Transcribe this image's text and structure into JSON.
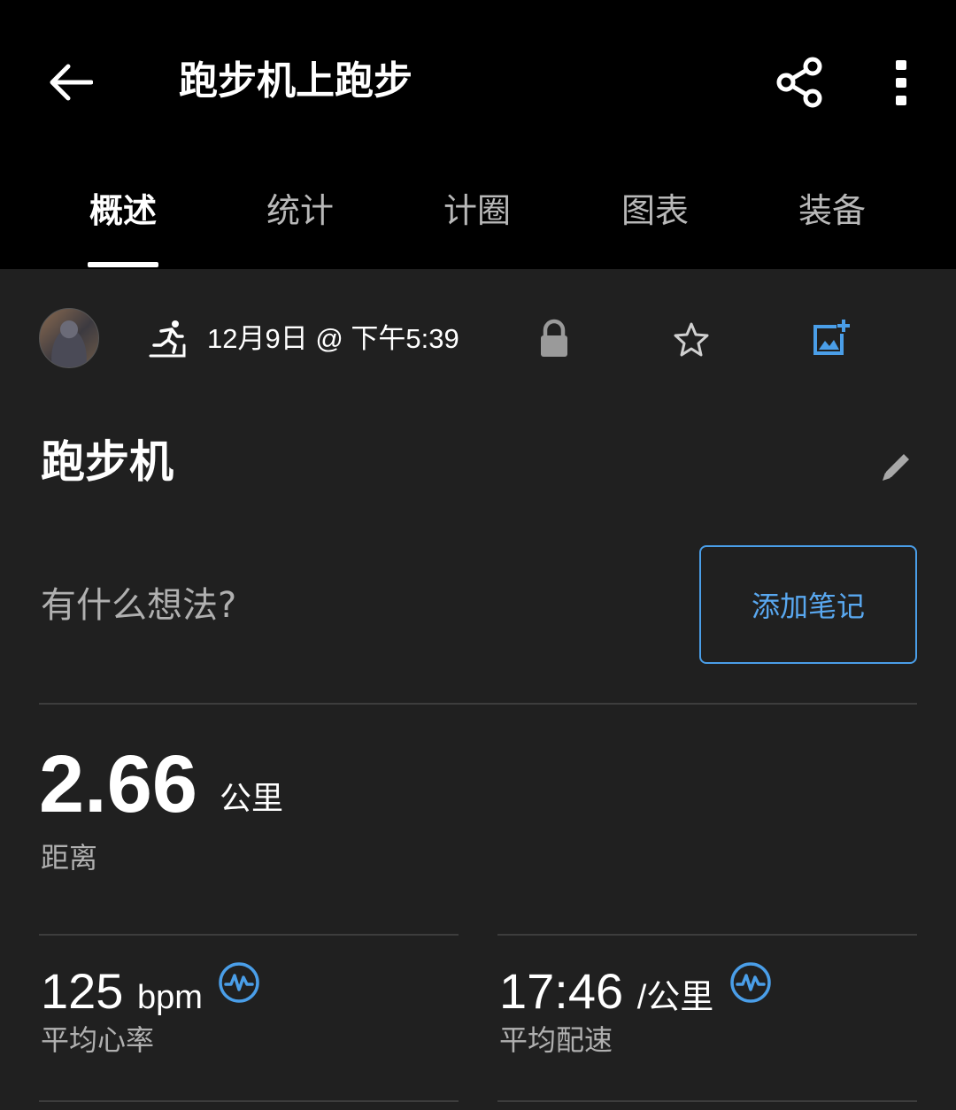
{
  "header": {
    "title": "跑步机上跑步",
    "back_icon": "arrow-left-icon",
    "share_icon": "share-icon",
    "more_icon": "more-vertical-icon"
  },
  "tabs": [
    {
      "label": "概述",
      "active": true
    },
    {
      "label": "统计",
      "active": false
    },
    {
      "label": "计圈",
      "active": false
    },
    {
      "label": "图表",
      "active": false
    },
    {
      "label": "装备",
      "active": false
    }
  ],
  "activity_meta": {
    "datetime": "12月9日 @ 下午5:39",
    "activity_icon": "treadmill-run-icon",
    "privacy_icon": "lock-icon",
    "favorite_icon": "star-outline-icon",
    "add_photo_icon": "add-photo-icon"
  },
  "activity": {
    "name": "跑步机",
    "edit_icon": "pencil-icon"
  },
  "notes": {
    "prompt": "有什么想法?",
    "add_button": "添加笔记"
  },
  "distance": {
    "value": "2.66",
    "unit": "公里",
    "label": "距离"
  },
  "stats": [
    {
      "value": "125",
      "unit": "bpm",
      "label": "平均心率",
      "icon": "heart-rate-icon"
    },
    {
      "value": "17:46",
      "unit": "/公里",
      "label": "平均配速",
      "icon": "heart-rate-icon"
    }
  ],
  "colors": {
    "background": "#202020",
    "header": "#000000",
    "accent": "#4a9ee8",
    "secondary_text": "#b0b0b0"
  }
}
